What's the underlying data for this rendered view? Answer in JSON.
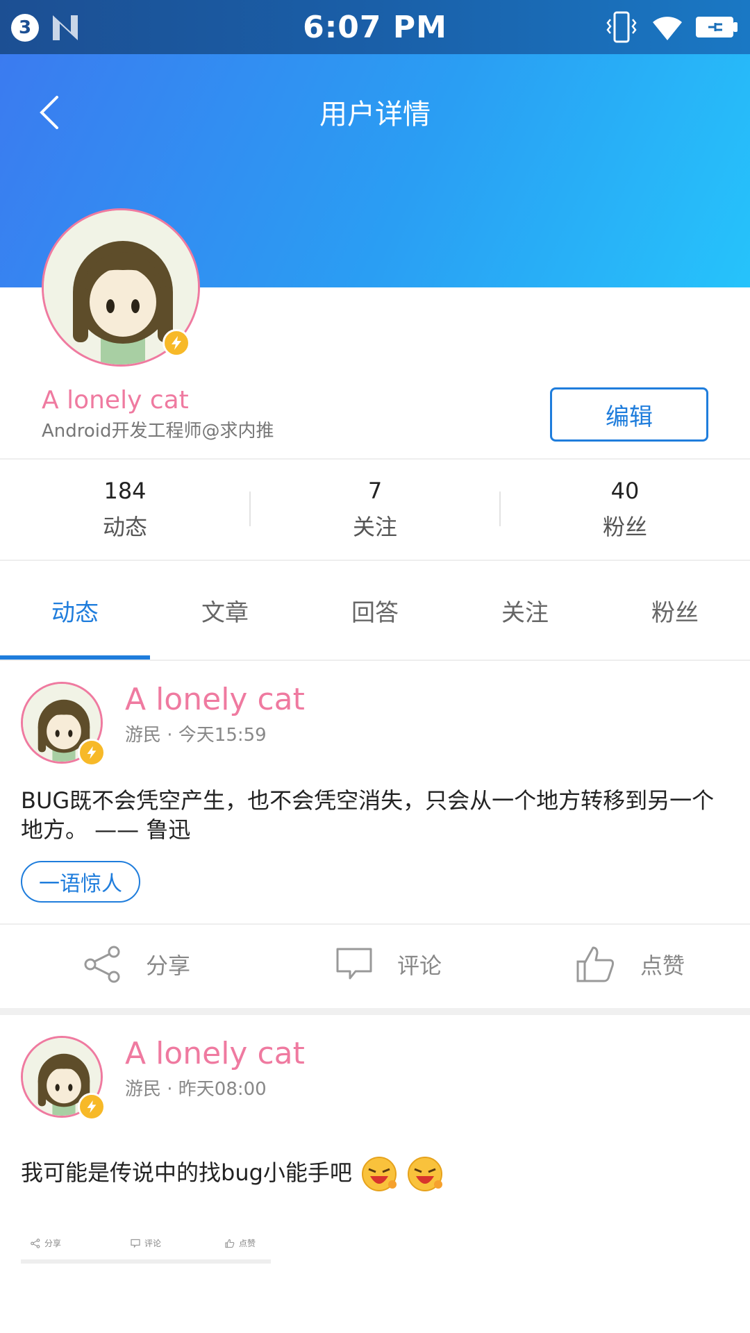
{
  "status_bar": {
    "notification_count": "3",
    "time": "6:07 PM",
    "icons": [
      "n-icon",
      "vibrate-icon",
      "wifi-icon",
      "battery-icon"
    ]
  },
  "header": {
    "title": "用户详情",
    "gradient_start": "#3b7bf0",
    "gradient_end": "#26c3fb"
  },
  "profile": {
    "name": "A lonely cat",
    "bio": "Android开发工程师@求内推",
    "edit_label": "编辑"
  },
  "stats": [
    {
      "value": "184",
      "label": "动态"
    },
    {
      "value": "7",
      "label": "关注"
    },
    {
      "value": "40",
      "label": "粉丝"
    }
  ],
  "tabs": [
    {
      "label": "动态",
      "active": true
    },
    {
      "label": "文章",
      "active": false
    },
    {
      "label": "回答",
      "active": false
    },
    {
      "label": "关注",
      "active": false
    },
    {
      "label": "粉丝",
      "active": false
    }
  ],
  "posts": [
    {
      "author": "A lonely cat",
      "meta": "游民 · 今天15:59",
      "text": "BUG既不会凭空产生，也不会凭空消失，只会从一个地方转移到另一个地方。 —— 鲁迅",
      "tag": "一语惊人",
      "actions": {
        "share": "分享",
        "comment": "评论",
        "like": "点赞"
      }
    },
    {
      "author": "A lonely cat",
      "meta": "游民 · 昨天08:00",
      "text": "我可能是传说中的找bug小能手吧",
      "actions": {
        "share": "分享",
        "comment": "评论",
        "like": "点赞"
      }
    }
  ],
  "colors": {
    "accent": "#1f7ddc",
    "name_pink": "#ef7aa0",
    "badge_yellow": "#f7b928"
  }
}
